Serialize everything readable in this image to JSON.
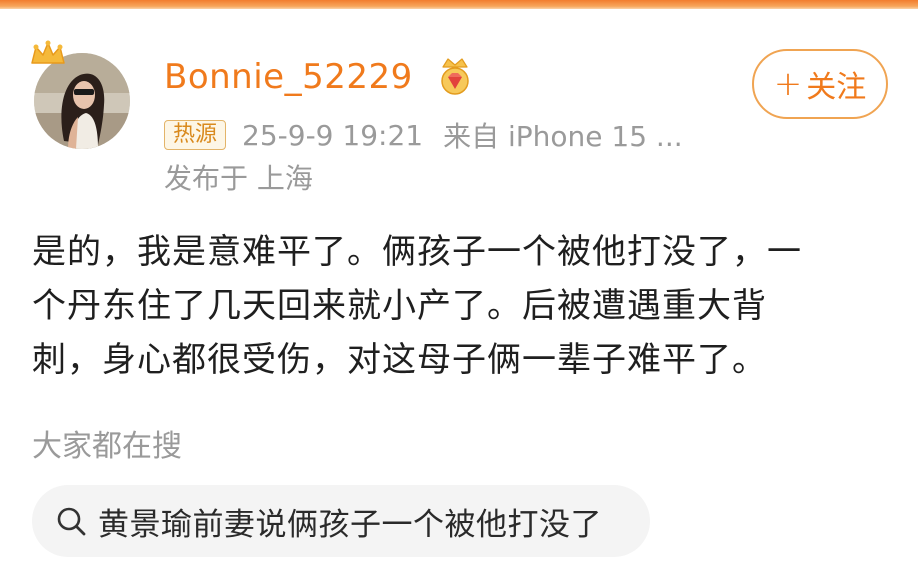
{
  "post": {
    "author": {
      "username": "Bonnie_52229",
      "avatar_icon": "avatar-photo",
      "badge_icons": [
        "crown-icon",
        "vip-medal-icon"
      ]
    },
    "source_tag": "热源",
    "timestamp": "25-9-9 19:21",
    "device": "来自 iPhone 15 ...",
    "location": "发布于 上海",
    "follow_button": {
      "plus": "+",
      "label": "关注"
    },
    "body_lines": [
      "是的，我是意难平了。俩孩子一个被他打没了，一",
      "个丹东住了几天回来就小产了。后被遭遇重大背",
      "刺，身心都很受伤，对这母子俩一辈子难平了。"
    ]
  },
  "hot_search": {
    "title": "大家都在搜",
    "query": "黄景瑜前妻说俩孩子一个被他打没了",
    "icon": "search-icon"
  },
  "colors": {
    "accent": "#f07a1c",
    "meta_gray": "#9a9a9a",
    "chip_bg": "#f4f4f4"
  }
}
